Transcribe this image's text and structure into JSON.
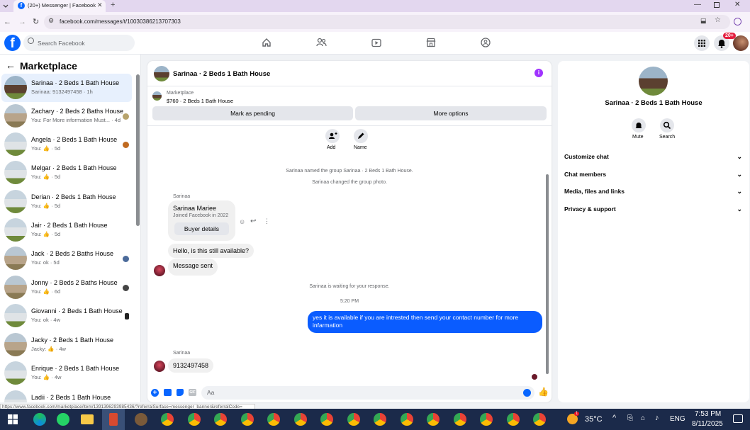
{
  "browser": {
    "tab_title": "(20+) Messenger | Facebook",
    "url": "facebook.com/messages/t/10030386213707303",
    "status_url": "https://www.facebook.com/marketplace/item/1391396293985436/?referralSurface=messenger_banner&referralCode="
  },
  "fbnav": {
    "search_placeholder": "Search Facebook",
    "notif_badge": "20+"
  },
  "sidebar": {
    "title": "Marketplace",
    "conversations": [
      {
        "name": "Sarinaa · 2 Beds 1 Bath House",
        "preview": "Sarinaa: 9132497458 · 1h"
      },
      {
        "name": "Zachary · 2 Beds 2 Baths House",
        "preview": "You: For More information Must... · 4d"
      },
      {
        "name": "Angela · 2 Beds 1 Bath House",
        "preview": "You: 👍 · 5d"
      },
      {
        "name": "Melgar · 2 Beds 1 Bath House",
        "preview": "You: 👍 · 5d"
      },
      {
        "name": "Derian · 2 Beds 1 Bath House",
        "preview": "You: 👍 · 5d"
      },
      {
        "name": "Jair · 2 Beds 1 Bath House",
        "preview": "You: 👍 · 5d"
      },
      {
        "name": "Jack · 2 Beds 2 Baths House",
        "preview": "You: ok · 5d"
      },
      {
        "name": "Jonny · 2 Beds 2 Baths House",
        "preview": "You: 👍 · 6d"
      },
      {
        "name": "Giovanni · 2 Beds 1 Bath House",
        "preview": "You: ok · 4w"
      },
      {
        "name": "Jacky · 2 Beds 1 Bath House",
        "preview": "Jacky: 👍 · 4w"
      },
      {
        "name": "Enrique · 2 Beds 1 Bath House",
        "preview": "You: 👍 · 4w"
      },
      {
        "name": "Ladii · 2 Beds 1 Bath House",
        "preview": ""
      }
    ]
  },
  "chat": {
    "header_title": "Sarinaa · 2 Beds 1 Bath House",
    "listing_label": "Marketplace",
    "listing_text": "$760 · 2 Beds 1 Bath House",
    "mark_pending": "Mark as pending",
    "more_options": "More options",
    "add_label": "Add",
    "name_label": "Name",
    "sys1": "Sarinaa named the group Sarinaa · 2 Beds 1 Bath House.",
    "sys2": "Sarinaa changed the group photo.",
    "sender1": "Sarinaa",
    "card_name": "Sarinaa Mariee",
    "card_joined": "Joined Facebook in 2022",
    "buyer_details": "Buyer details",
    "msg_available": "Hello, is this still available?",
    "msg_sent": "Message sent",
    "sys3": "Sarinaa is waiting for your response.",
    "time": "5:20 PM",
    "my_msg": "yes it is available if you are intrested then send your contact number for more infarmation",
    "sender2": "Sarinaa",
    "msg_number": "9132497458",
    "composer_placeholder": "Aa"
  },
  "info_panel": {
    "title": "Sarinaa · 2 Beds 1 Bath House",
    "mute": "Mute",
    "search": "Search",
    "sections": [
      "Customize chat",
      "Chat members",
      "Media, files and links",
      "Privacy & support"
    ]
  },
  "taskbar": {
    "temperature": "35°C",
    "lang": "ENG",
    "time": "7:53 PM",
    "date": "8/11/2025",
    "weather_badge": "1"
  },
  "colors": {
    "fb_blue": "#0866ff",
    "my_bubble": "#0a5cff",
    "accent_purple": "#a033ff"
  }
}
